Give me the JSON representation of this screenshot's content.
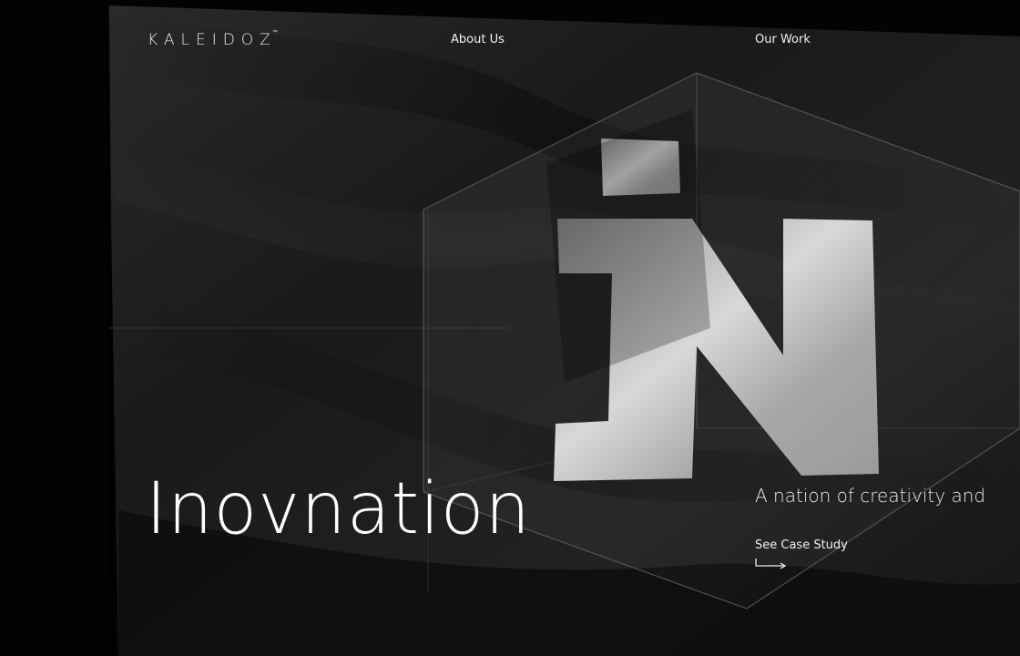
{
  "brand": {
    "logo_text": "KALEIDOZ",
    "logo_mark": "™"
  },
  "nav": {
    "about_label": "About Us",
    "work_label": "Our Work"
  },
  "hero": {
    "title": "Inovnation",
    "tagline": "A nation of creativity and",
    "cta_label": "See Case Study",
    "cta_icon": "arrow-right-icon",
    "flag_letter": "N"
  },
  "colors": {
    "background": "#050505",
    "text": "#ffffff",
    "flag": "#1c1c1c"
  }
}
